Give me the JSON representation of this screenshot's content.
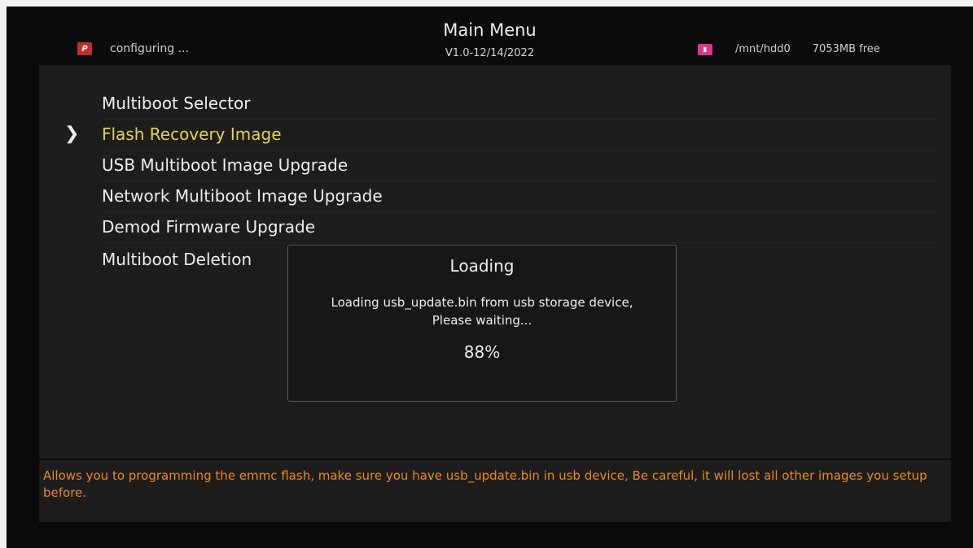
{
  "header": {
    "title": "Main Menu",
    "version": "V1.0-12/14/2022",
    "status_text": "configuring ...",
    "status_icon": "p-logo-icon",
    "storage_icon": "hdd-icon",
    "mount_path": "/mnt/hdd0",
    "free_space": "7053MB free"
  },
  "menu": {
    "items": [
      {
        "label": "Multiboot Selector"
      },
      {
        "label": "Flash Recovery Image",
        "selected": true
      },
      {
        "label": "USB Multiboot Image Upgrade"
      },
      {
        "label": "Network Multiboot Image Upgrade"
      },
      {
        "label": "Demod Firmware Upgrade"
      },
      {
        "label": "Multiboot Deletion"
      }
    ],
    "selector_glyph": "➤"
  },
  "dialog": {
    "title": "Loading",
    "message": "Loading usb_update.bin from usb storage device, Please waiting...",
    "progress": "88%"
  },
  "help": {
    "text": "Allows you to programming the emmc flash, make sure you have usb_update.bin in usb device, Be careful, it will lost all other images you setup before."
  },
  "colors": {
    "selected": "#e6d34e",
    "help_text": "#ea8a1f",
    "background": "#0b0b0b"
  }
}
